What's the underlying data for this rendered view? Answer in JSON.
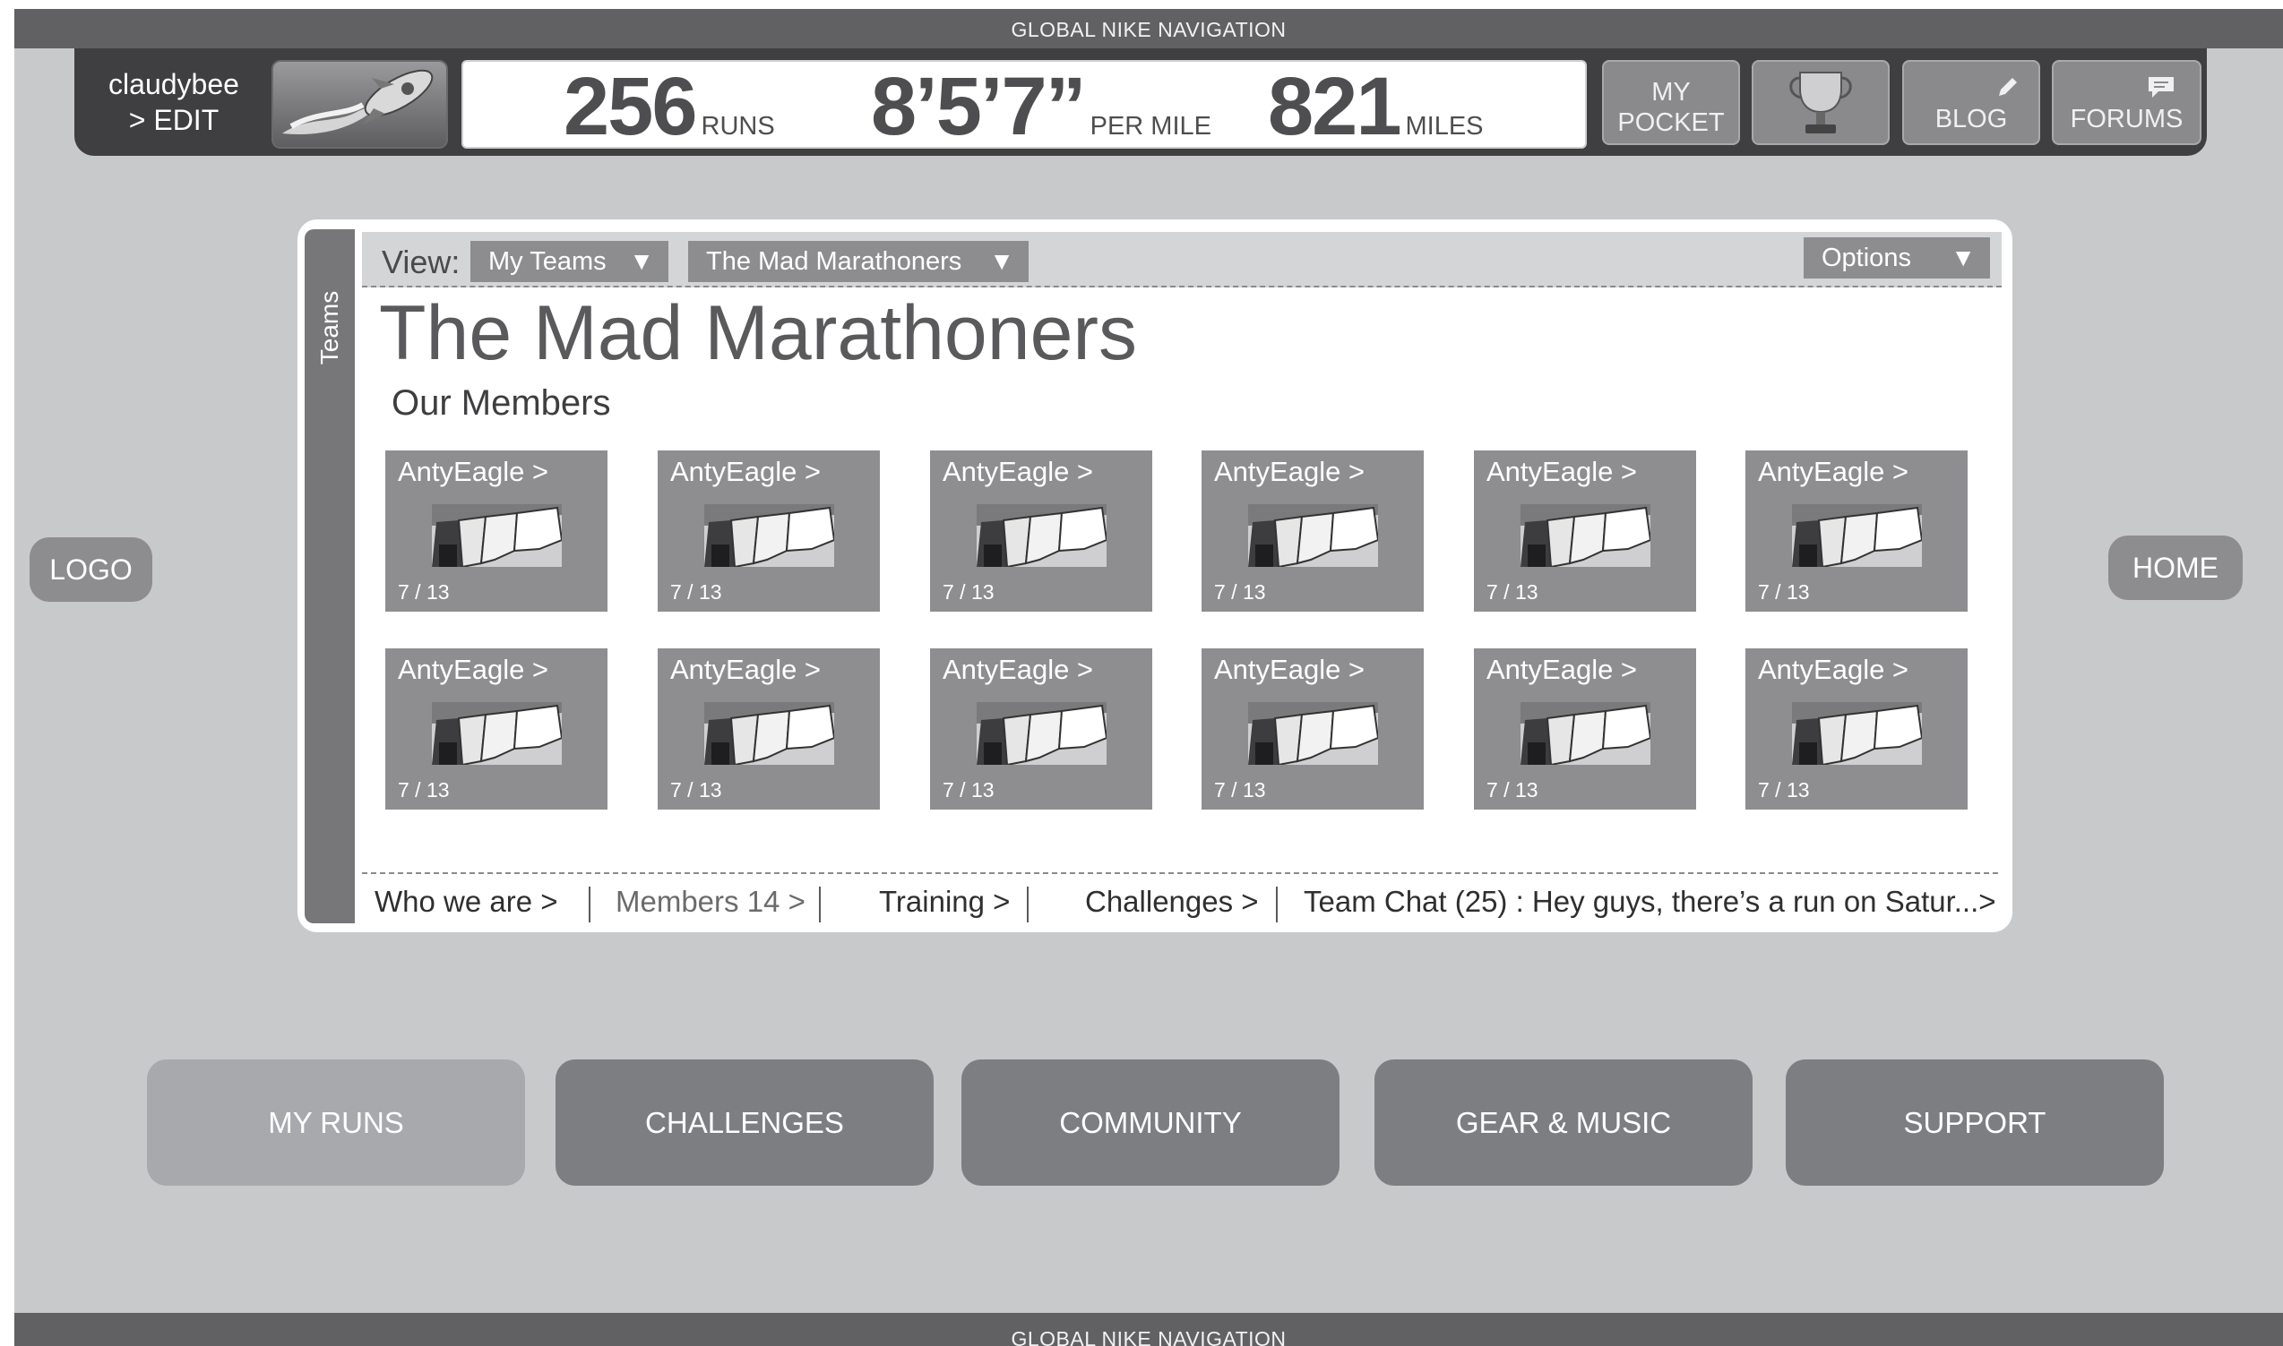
{
  "global_nav": {
    "top_label": "GLOBAL NIKE NAVIGATION",
    "bottom_label": "GLOBAL NIKE NAVIGATION"
  },
  "header": {
    "username": "claudybee",
    "edit_link": "> EDIT",
    "stats": [
      {
        "value": "256",
        "unit": "RUNS"
      },
      {
        "value": "8’5’7”",
        "unit": "PER MILE"
      },
      {
        "value": "821",
        "unit": "MILES"
      }
    ],
    "buttons": {
      "my_pocket": "MY\nPOCKET",
      "trophy_icon": "trophy-icon",
      "blog": "BLOG",
      "forums": "FORUMS"
    }
  },
  "side": {
    "logo": "LOGO",
    "home": "HOME"
  },
  "teams_panel": {
    "tab_label": "Teams",
    "view_label": "View:",
    "view_dropdown": "My Teams",
    "team_dropdown": "The Mad Marathoners",
    "options_dropdown": "Options",
    "dropdown_arrow": "▼",
    "team_name": "The Mad Marathoners",
    "members_heading": "Our Members",
    "members": [
      {
        "name": "AntyEagle >",
        "date": "7 / 13"
      },
      {
        "name": "AntyEagle >",
        "date": "7 / 13"
      },
      {
        "name": "AntyEagle >",
        "date": "7 / 13"
      },
      {
        "name": "AntyEagle >",
        "date": "7 / 13"
      },
      {
        "name": "AntyEagle >",
        "date": "7 / 13"
      },
      {
        "name": "AntyEagle >",
        "date": "7 / 13"
      },
      {
        "name": "AntyEagle >",
        "date": "7 / 13"
      },
      {
        "name": "AntyEagle >",
        "date": "7 / 13"
      },
      {
        "name": "AntyEagle >",
        "date": "7 / 13"
      },
      {
        "name": "AntyEagle >",
        "date": "7 / 13"
      },
      {
        "name": "AntyEagle >",
        "date": "7 / 13"
      },
      {
        "name": "AntyEagle >",
        "date": "7 / 13"
      }
    ],
    "footer_links": {
      "who_we_are": "Who we are >",
      "members": "Members 14 >",
      "training": "Training >",
      "challenges": "Challenges >",
      "team_chat": "Team Chat (25) : Hey guys, there’s a run on Satur...>"
    }
  },
  "bottom_nav": {
    "my_runs": "MY RUNS",
    "challenges": "CHALLENGES",
    "community": "COMMUNITY",
    "gear_music": "GEAR & MUSIC",
    "support": "SUPPORT"
  },
  "colors": {
    "background": "#c8c9cb",
    "bar_dark": "#3f3f42",
    "tile": "#8e8e91",
    "active_nav": "#a8a9ac"
  }
}
